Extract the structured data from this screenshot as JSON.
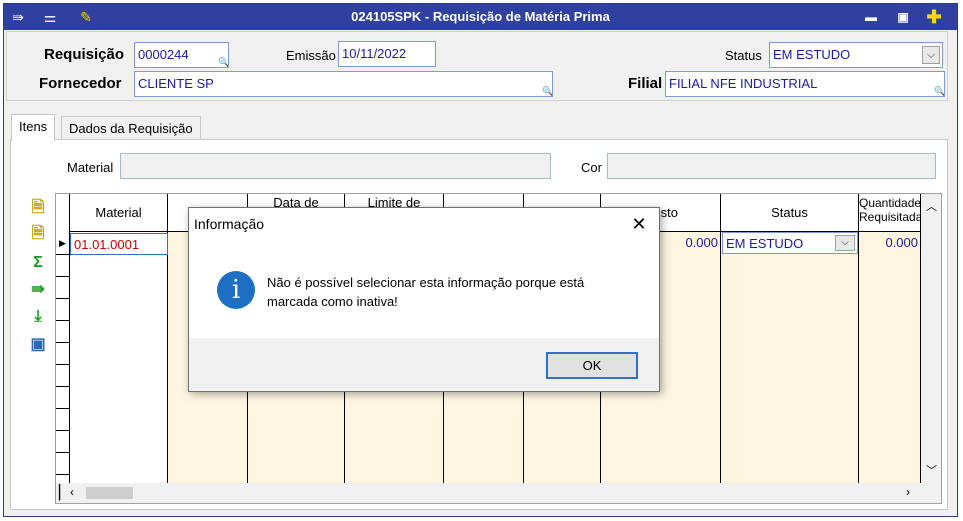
{
  "window": {
    "title": "024105SPK - Requisição de Matéria Prima",
    "min_label": "▬",
    "max_label": "▣",
    "close_label": "✚"
  },
  "header": {
    "requisicao_label": "Requisição",
    "requisicao_value": "0000244",
    "emissao_label": "Emissão",
    "emissao_value": "10/11/2022",
    "status_label": "Status",
    "status_value": "EM ESTUDO",
    "fornecedor_label": "Fornecedor",
    "fornecedor_value": "CLIENTE SP",
    "filial_label": "Filial",
    "filial_value": "FILIAL NFE INDUSTRIAL"
  },
  "tabs": [
    {
      "label": "Itens"
    },
    {
      "label": "Dados da Requisição"
    }
  ],
  "filter": {
    "material_label": "Material",
    "cor_label": "Cor"
  },
  "grid": {
    "headers": [
      "Material",
      "",
      "Data de",
      "Limite de",
      "",
      "",
      "sto",
      "Status",
      "Quantidade Requisitada"
    ],
    "row": {
      "material": "01.01.0001",
      "custo": "0.000",
      "status": "EM ESTUDO",
      "quantidade": "0.000"
    }
  },
  "dialog": {
    "title": "Informação",
    "message": "Não é possível selecionar esta informação porque está marcada como inativa!",
    "ok_label": "OK",
    "icon_glyph": "i"
  },
  "colors": {
    "titlebar": "#3040a0",
    "field_text": "#1a1aa0",
    "grid_fill": "#fdf5e0",
    "info_icon": "#1c6fc2",
    "material_text": "#cc0000"
  }
}
